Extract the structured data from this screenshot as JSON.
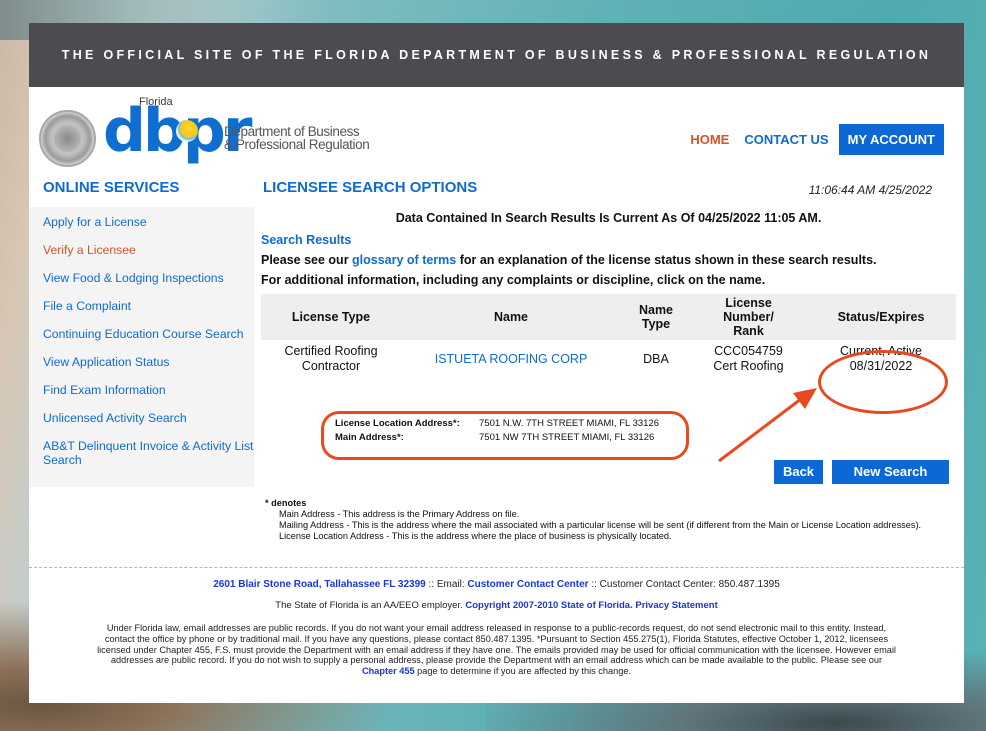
{
  "banner": {
    "title": "THE OFFICIAL SITE OF THE FLORIDA DEPARTMENT OF BUSINESS & PROFESSIONAL REGULATION"
  },
  "logo": {
    "state": "Florida",
    "brand": "dbpr",
    "dept_line1": "Department of Business",
    "dept_line2": "& Professional Regulation"
  },
  "nav": {
    "home": "HOME",
    "contact": "CONTACT US",
    "account": "MY ACCOUNT"
  },
  "sidebar": {
    "title": "ONLINE SERVICES",
    "items": [
      {
        "label": "Apply for a License"
      },
      {
        "label": "Verify a Licensee",
        "active": true
      },
      {
        "label": "View Food & Lodging Inspections"
      },
      {
        "label": "File a Complaint"
      },
      {
        "label": "Continuing Education Course Search"
      },
      {
        "label": "View Application Status"
      },
      {
        "label": "Find Exam Information"
      },
      {
        "label": "Unlicensed Activity Search"
      },
      {
        "label": "AB&T Delinquent Invoice & Activity List Search"
      }
    ]
  },
  "main": {
    "title": "LICENSEE SEARCH OPTIONS",
    "timestamp": "11:06:44 AM 4/25/2022",
    "current_as_of": "Data Contained In Search Results Is Current As Of 04/25/2022 11:05 AM.",
    "search_results_label": "Search Results",
    "glossary_prefix": "Please see our ",
    "glossary_link": "glossary of terms",
    "glossary_suffix": " for an explanation of the license status shown in these search results.",
    "additional_info": "For additional information, including any complaints or discipline, click on the name.",
    "table": {
      "headers": [
        "License Type",
        "Name",
        "Name Type",
        "License Number/ Rank",
        "Status/Expires"
      ],
      "rows": [
        {
          "license_type_1": "Certified Roofing",
          "license_type_2": "Contractor",
          "name": "ISTUETA ROOFING CORP",
          "name_type": "DBA",
          "license_number": "CCC054759",
          "rank": "Cert Roofing",
          "status": "Current, Active",
          "expires": "08/31/2022"
        }
      ]
    },
    "addresses": [
      {
        "label": "License Location Address*:",
        "value": "7501 N.W. 7TH STREET MIAMI, FL 33126"
      },
      {
        "label": "Main Address*:",
        "value": "7501 NW 7TH STREET MIAMI, FL 33126"
      }
    ],
    "buttons": {
      "back": "Back",
      "new_search": "New Search"
    },
    "denotes": {
      "title": "* denotes",
      "lines": [
        "Main Address - This address is the Primary Address on file.",
        "Mailing Address - This is the address where the mail associated with a particular license will be sent (if different from the Main or License Location addresses).",
        "License Location Address - This is the address where the place of business is physically located."
      ]
    }
  },
  "footer": {
    "address_link": "2601 Blair Stone Road, Tallahassee FL 32399",
    "email_label": " :: Email: ",
    "email_link": "Customer Contact Center",
    "phone_text": " :: Customer Contact Center: 850.487.1395",
    "eeo_text": "The State of Florida is an AA/EEO employer. ",
    "copyright_link": "Copyright 2007-2010 State of Florida.",
    "privacy_link": "Privacy Statement",
    "legal_text": "Under Florida law, email addresses are public records. If you do not want your email address released in response to a public-records request, do not send electronic mail to this entity. Instead, contact the office by phone or by traditional mail. If you have any questions, please contact 850.487.1395. *Pursuant to Section 455.275(1), Florida Statutes, effective October 1, 2012, licensees licensed under Chapter 455, F.S. must provide the Department with an email address if they have one. The emails provided may be used for official communication with the licensee. However email addresses are public record. If you do not wish to supply a personal address, please provide the Department with an email address which can be made available to the public. Please see our ",
    "chapter_link": "Chapter 455",
    "legal_suffix": " page to determine if you are affected by this change."
  },
  "colors": {
    "brand_blue": "#0e6bd1",
    "accent_orange": "#d4532b",
    "annotation_red": "#e84a1f",
    "banner_gray": "#4d4b50"
  }
}
